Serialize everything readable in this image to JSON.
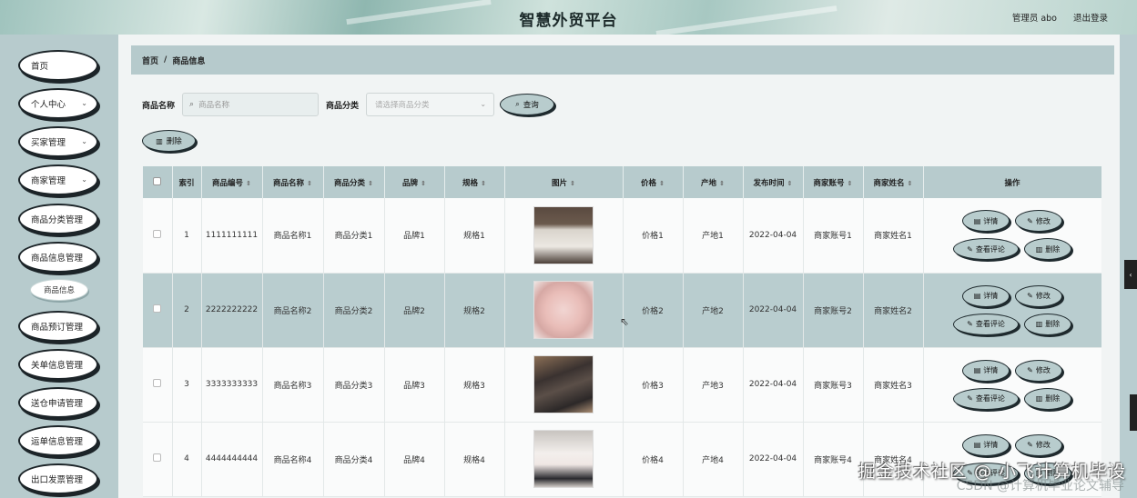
{
  "header": {
    "title": "智慧外贸平台",
    "user": "管理员 abo",
    "logout": "退出登录"
  },
  "sidebar": {
    "items": [
      {
        "label": "首页",
        "chevron": false
      },
      {
        "label": "个人中心",
        "chevron": true
      },
      {
        "label": "买家管理",
        "chevron": true
      },
      {
        "label": "商家管理",
        "chevron": true
      },
      {
        "label": "商品分类管理",
        "chevron": false
      },
      {
        "label": "商品信息管理",
        "chevron": false
      },
      {
        "label": "商品信息",
        "sub": true
      },
      {
        "label": "商品预订管理",
        "chevron": false
      },
      {
        "label": "关单信息管理",
        "chevron": false
      },
      {
        "label": "送仓申请管理",
        "chevron": false
      },
      {
        "label": "运单信息管理",
        "chevron": false
      },
      {
        "label": "出口发票管理",
        "chevron": false
      }
    ]
  },
  "breadcrumb": {
    "home": "首页",
    "sep": "/",
    "current": "商品信息"
  },
  "search": {
    "name_label": "商品名称",
    "name_placeholder": "商品名称",
    "category_label": "商品分类",
    "category_placeholder": "请选择商品分类",
    "query_label": "查询",
    "delete_label": "删除"
  },
  "table": {
    "columns": [
      "索引",
      "商品编号",
      "商品名称",
      "商品分类",
      "品牌",
      "规格",
      "图片",
      "价格",
      "产地",
      "发布时间",
      "商家账号",
      "商家姓名",
      "操作"
    ],
    "rows": [
      {
        "index": "1",
        "code": "1111111111",
        "name": "商品名称1",
        "category": "商品分类1",
        "brand": "品牌1",
        "spec": "规格1",
        "price": "价格1",
        "origin": "产地1",
        "date": "2022-04-04",
        "account": "商家账号1",
        "merchant": "商家姓名1"
      },
      {
        "index": "2",
        "code": "2222222222",
        "name": "商品名称2",
        "category": "商品分类2",
        "brand": "品牌2",
        "spec": "规格2",
        "price": "价格2",
        "origin": "产地2",
        "date": "2022-04-04",
        "account": "商家账号2",
        "merchant": "商家姓名2"
      },
      {
        "index": "3",
        "code": "3333333333",
        "name": "商品名称3",
        "category": "商品分类3",
        "brand": "品牌3",
        "spec": "规格3",
        "price": "价格3",
        "origin": "产地3",
        "date": "2022-04-04",
        "account": "商家账号3",
        "merchant": "商家姓名3"
      },
      {
        "index": "4",
        "code": "4444444444",
        "name": "商品名称4",
        "category": "商品分类4",
        "brand": "品牌4",
        "spec": "规格4",
        "price": "价格4",
        "origin": "产地4",
        "date": "2022-04-04",
        "account": "商家账号4",
        "merchant": "商家姓名4"
      }
    ],
    "actions": {
      "detail": "详情",
      "edit": "修改",
      "comments": "查看评论",
      "delete": "删除"
    }
  },
  "watermark": "掘金技术社区 @ 小飞计算机毕设",
  "watermark_sub": "CSDN @计算机毕业论文辅导"
}
